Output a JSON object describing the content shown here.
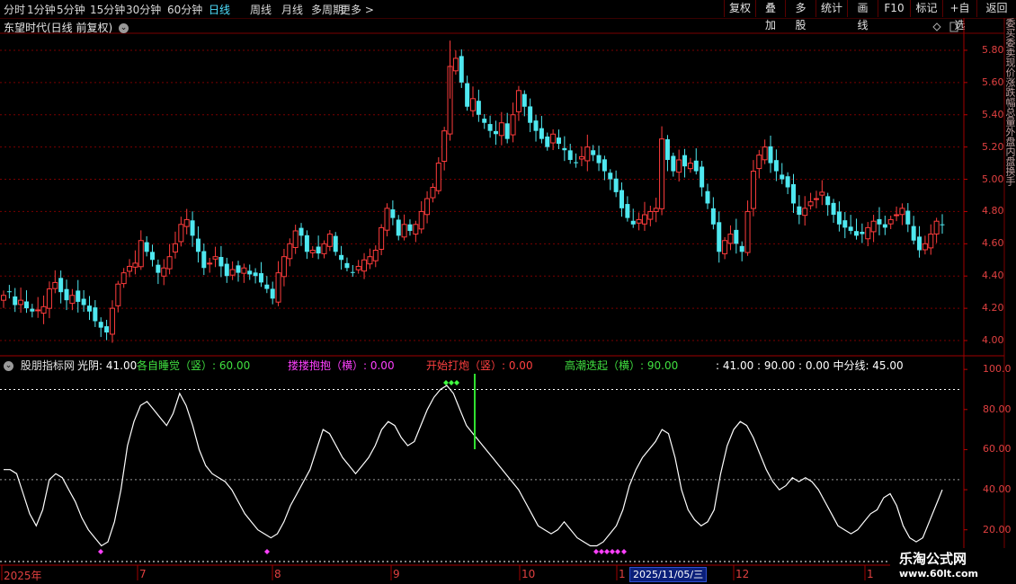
{
  "toolbar": {
    "periods": [
      "分时",
      "1分钟",
      "5分钟",
      "15分钟",
      "30分钟",
      "60分钟",
      "日线",
      "周线",
      "月线",
      "多周期",
      "更多 >"
    ],
    "active_period": "日线",
    "right_buttons": [
      "复权",
      "叠加",
      "多股",
      "统计",
      "画线",
      "F10",
      "标记",
      "+自选",
      "返回"
    ]
  },
  "stock": {
    "title": "东望时代(日线 前复权)"
  },
  "price_axis": {
    "ticks": [
      "5.80",
      "5.60",
      "5.40",
      "5.20",
      "5.00",
      "4.80",
      "4.60",
      "4.40",
      "4.20",
      "4.00"
    ]
  },
  "indicator": {
    "name": "股朋指标网",
    "items": [
      {
        "text": "光阴: 41.00",
        "color": "#ffffff"
      },
      {
        "text": "各自睡觉（竖）: 60.00",
        "color": "#40e040"
      },
      {
        "text": "搂搂抱抱（横）: 0.00",
        "color": "#ff40ff"
      },
      {
        "text": "开始打炮（竖）: 0.00",
        "color": "#ff4040"
      },
      {
        "text": "高潮迭起（横）: 90.00",
        "color": "#40e040"
      },
      {
        "text": ": 41.00 : 90.00 : 0.00  中分线: 45.00",
        "color": "#ffffff"
      }
    ],
    "axis_ticks": [
      "100.0",
      "80.00",
      "60.00",
      "40.00",
      "20.00"
    ]
  },
  "date_axis": {
    "labels": [
      "2025年",
      "7",
      "8",
      "9",
      "10",
      "1",
      "12",
      "1"
    ],
    "cursor": "2025/11/05/三"
  },
  "watermark": {
    "line1": "乐淘公式网",
    "line2": "www.60lt.com"
  },
  "side_strip": {
    "text": "委买委卖现价涨跌幅总量外盘内盘换手"
  },
  "colors": {
    "up": "#ff3c3c",
    "down": "#4fe8f0",
    "bg": "#000000",
    "grid": "#7a0000"
  },
  "chart_data": {
    "type": "candlestick",
    "price_range": [
      3.95,
      5.9
    ],
    "indicator_range": [
      10,
      105
    ],
    "price_close": [
      4.28,
      4.3,
      4.22,
      4.25,
      4.2,
      4.18,
      4.19,
      4.21,
      4.32,
      4.36,
      4.3,
      4.25,
      4.28,
      4.24,
      4.22,
      4.18,
      4.12,
      4.08,
      4.05,
      4.2,
      4.35,
      4.42,
      4.46,
      4.48,
      4.62,
      4.55,
      4.5,
      4.42,
      4.45,
      4.52,
      4.6,
      4.72,
      4.75,
      4.65,
      4.55,
      4.45,
      4.48,
      4.52,
      4.46,
      4.4,
      4.44,
      4.42,
      4.45,
      4.41,
      4.4,
      4.36,
      4.32,
      4.26,
      4.42,
      4.52,
      4.6,
      4.68,
      4.65,
      4.55,
      4.56,
      4.54,
      4.6,
      4.66,
      4.55,
      4.5,
      4.45,
      4.42,
      4.46,
      4.5,
      4.52,
      4.56,
      4.7,
      4.82,
      4.76,
      4.65,
      4.72,
      4.68,
      4.72,
      4.8,
      4.88,
      4.95,
      5.1,
      5.3,
      5.7,
      5.75,
      5.6,
      5.45,
      5.5,
      5.4,
      5.35,
      5.3,
      5.28,
      5.35,
      5.25,
      5.4,
      5.55,
      5.45,
      5.35,
      5.3,
      5.25,
      5.2,
      5.28,
      5.22,
      5.18,
      5.12,
      5.1,
      5.14,
      5.2,
      5.15,
      5.1,
      5.05,
      5.0,
      4.92,
      4.82,
      4.76,
      4.72,
      4.75,
      4.78,
      4.8,
      4.82,
      5.25,
      5.12,
      5.05,
      5.12,
      5.08,
      5.1,
      5.05,
      4.95,
      4.85,
      4.72,
      4.55,
      4.62,
      4.66,
      4.6,
      4.55,
      4.8,
      5.05,
      5.15,
      5.2,
      5.1,
      5.05,
      5.0,
      4.95,
      4.85,
      4.78,
      4.82,
      4.86,
      4.88,
      4.92,
      4.84,
      4.78,
      4.72,
      4.7,
      4.68,
      4.65,
      4.66,
      4.7,
      4.74,
      4.72,
      4.7,
      4.75,
      4.78,
      4.82,
      4.72,
      4.62,
      4.56,
      4.6,
      4.66,
      4.74,
      4.72
    ],
    "indicator_values": [
      50,
      50,
      48,
      38,
      28,
      22,
      30,
      45,
      48,
      46,
      40,
      34,
      26,
      20,
      16,
      12,
      14,
      24,
      40,
      62,
      74,
      82,
      84,
      80,
      76,
      72,
      78,
      88,
      82,
      72,
      60,
      52,
      48,
      46,
      44,
      40,
      34,
      28,
      24,
      20,
      18,
      16,
      18,
      24,
      32,
      38,
      44,
      50,
      60,
      70,
      68,
      62,
      56,
      52,
      48,
      52,
      56,
      62,
      70,
      74,
      72,
      66,
      62,
      64,
      72,
      80,
      86,
      90,
      92,
      88,
      80,
      72,
      68,
      64,
      60,
      56,
      52,
      48,
      44,
      40,
      34,
      28,
      22,
      20,
      18,
      20,
      24,
      20,
      16,
      14,
      12,
      12,
      14,
      18,
      22,
      30,
      42,
      50,
      56,
      60,
      64,
      70,
      68,
      56,
      40,
      30,
      25,
      22,
      24,
      30,
      48,
      62,
      70,
      74,
      72,
      66,
      58,
      50,
      44,
      40,
      42,
      46,
      44,
      46,
      44,
      40,
      34,
      28,
      22,
      20,
      18,
      20,
      24,
      28,
      30,
      36,
      38,
      32,
      22,
      16,
      14,
      16,
      24,
      32,
      40
    ],
    "series": [
      {
        "name": "光阴",
        "value": 41.0
      },
      {
        "name": "各自睡觉（竖）",
        "value": 60.0
      },
      {
        "name": "搂搂抱抱（横）",
        "value": 0.0
      },
      {
        "name": "开始打炮（竖）",
        "value": 0.0
      },
      {
        "name": "高潮迭起（横）",
        "value": 90.0
      },
      {
        "name": "中分线",
        "value": 45.0
      }
    ]
  }
}
